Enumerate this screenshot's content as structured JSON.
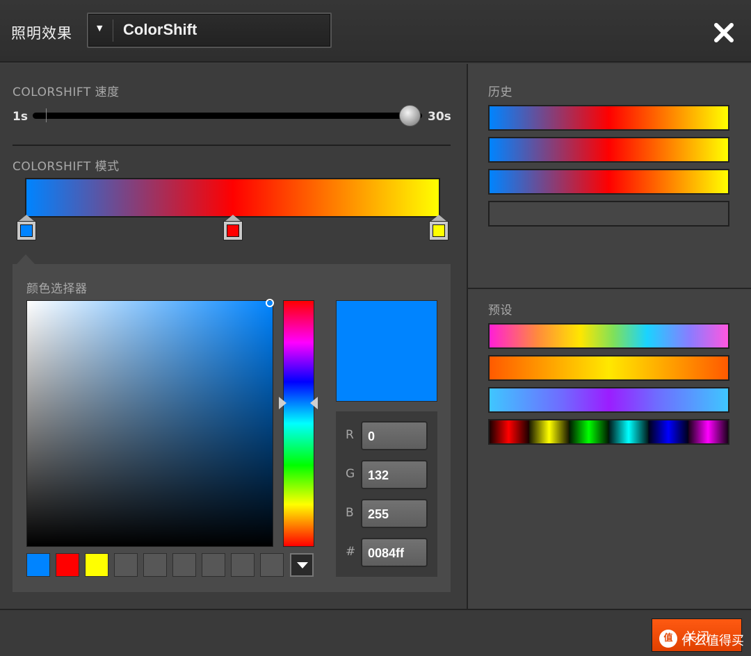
{
  "header": {
    "title": "照明效果",
    "mode_value": "ColorShift"
  },
  "speed": {
    "label": "COLORSHIFT 速度",
    "min_label": "1s",
    "max_label": "30s",
    "value_fraction": 0.97
  },
  "pattern": {
    "label": "COLORSHIFT 模式",
    "stops": [
      {
        "color": "#0084ff",
        "position": 0.0
      },
      {
        "color": "#ff0000",
        "position": 0.5
      },
      {
        "color": "#ffff00",
        "position": 1.0
      }
    ]
  },
  "picker": {
    "title": "颜色选择器",
    "current_hex_color": "#0084ff",
    "r_label": "R",
    "r": "0",
    "g_label": "G",
    "g": "132",
    "b_label": "B",
    "b": "255",
    "hex_label": "#",
    "hex": "0084ff",
    "swatches": [
      "#0084ff",
      "#ff0000",
      "#ffff00",
      "",
      "",
      "",
      "",
      "",
      ""
    ]
  },
  "history": {
    "label": "历史",
    "items": [
      "colorshift-blue-red-yellow",
      "colorshift-blue-red-yellow",
      "colorshift-blue-red-yellow",
      "empty"
    ]
  },
  "presets": {
    "label": "预设",
    "items": [
      "rainbow-pastel",
      "orange-yellow",
      "blue-purple",
      "segmented-spectrum"
    ]
  },
  "footer": {
    "close_button_label": "关闭",
    "watermark_logo": "值",
    "watermark_text": "什么值得买"
  },
  "colors": {
    "accent": "#ff4d0a",
    "background": "#3c3c3c"
  }
}
